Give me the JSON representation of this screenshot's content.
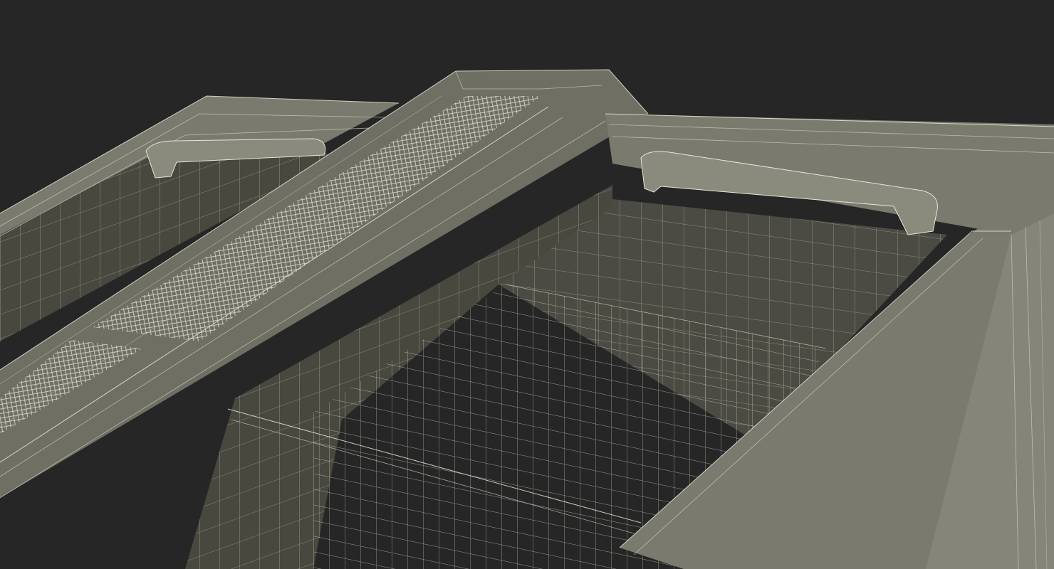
{
  "image": {
    "subject": "wireframe-render-chest-freezer",
    "colors": {
      "background": "#262626",
      "surface": "#7a7a6e",
      "surface_dark": "#5f5f56",
      "interior": "#45453f",
      "wire": "#e8e8d6"
    }
  }
}
